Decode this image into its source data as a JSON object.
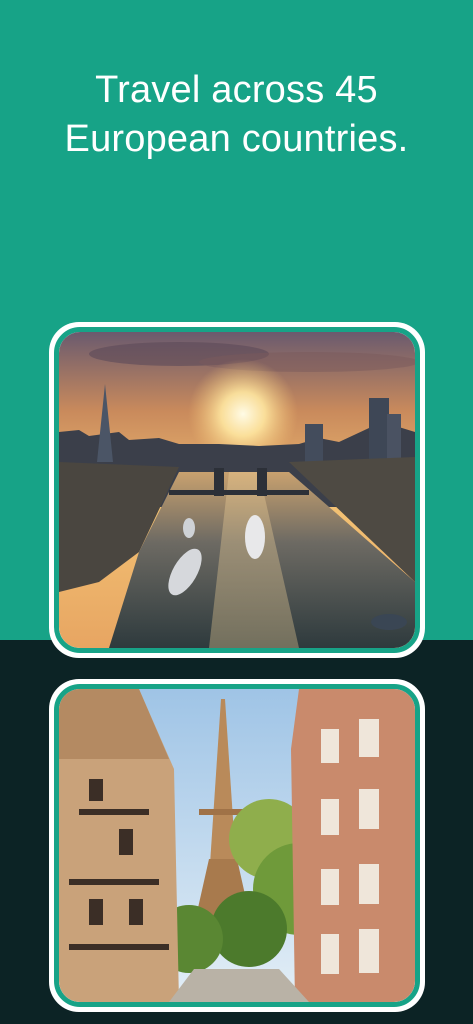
{
  "headline": {
    "line1": "Travel across 45",
    "line2": "European countries."
  },
  "colors": {
    "brand_green": "#17a387",
    "dark_background": "#0c2325",
    "card_frame": "#ffffff"
  },
  "photos": [
    {
      "subject": "london-thames-sunset-photo"
    },
    {
      "subject": "paris-eiffel-tower-street-photo"
    }
  ]
}
